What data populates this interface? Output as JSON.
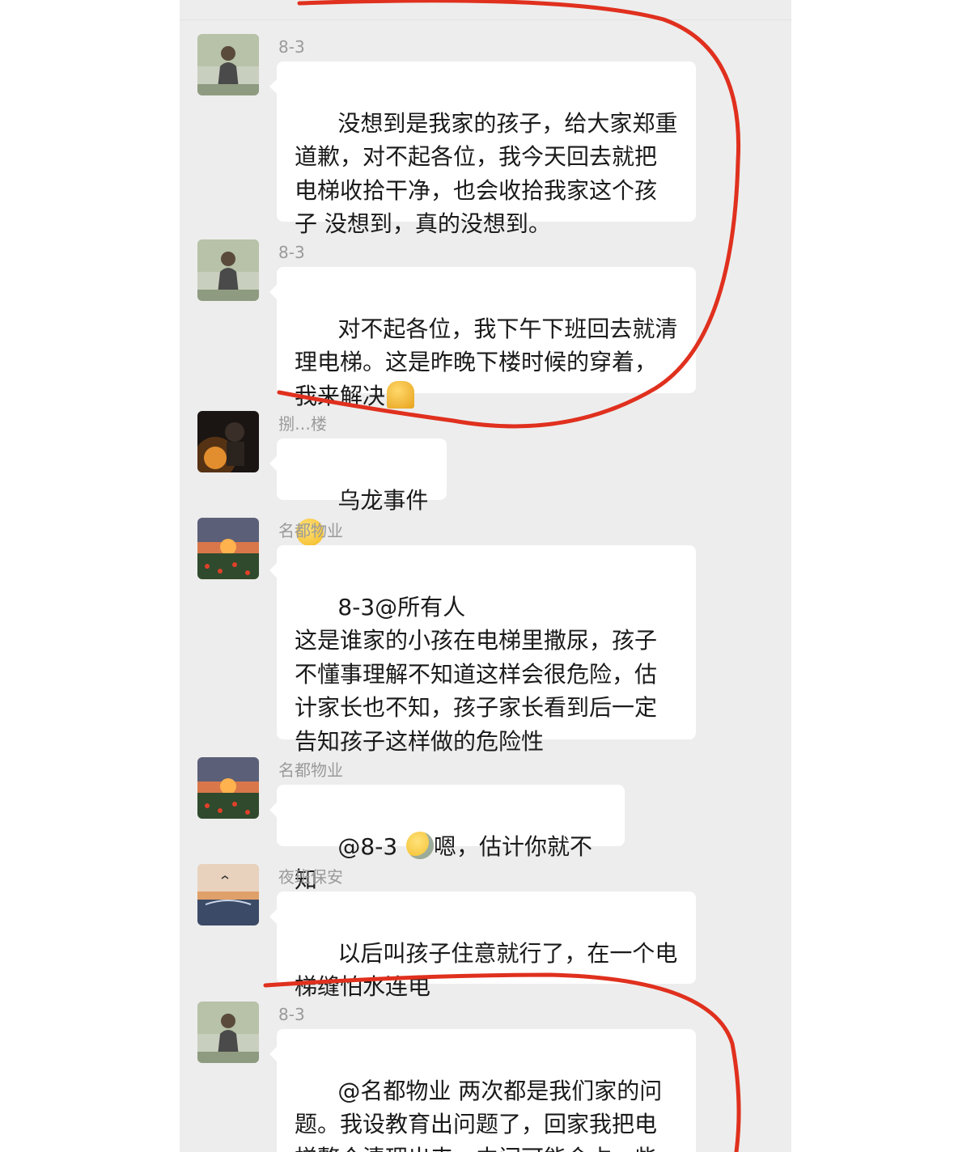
{
  "messages": [
    {
      "sender": "8-3",
      "text": "没想到是我家的孩子，给大家郑重道歉，对不起各位，我今天回去就把电梯收拾干净，也会收拾我家这个孩子 没想到，真的没想到。",
      "emoji": ""
    },
    {
      "sender": "8-3",
      "text": "对不起各位，我下午下班回去就清理电梯。这是昨晚下楼时候的穿着，我来解决",
      "emoji": "pray-emoji"
    },
    {
      "sender": "捌…楼",
      "text": "乌龙事件",
      "emoji": "thinking-emoji"
    },
    {
      "sender": "名都物业",
      "text": "8-3@所有人\n这是谁家的小孩在电梯里撒尿，孩子不懂事理解不知道这样会很危险，估计家长也不知，孩子家长看到后一定告知孩子这样做的危险性",
      "emoji": ""
    },
    {
      "sender": "名都物业",
      "text_before": "@8-3 ",
      "text": "嗯，估计你就不知",
      "emoji": "crying-laughing-emoji"
    },
    {
      "sender": "夜班保安",
      "text": "以后叫孩子住意就行了，在一个电梯缝怕水连电",
      "emoji": ""
    },
    {
      "sender": "8-3",
      "text": "@名都物业 两次都是我们家的问题。我设教育出问题了，回家我把电梯整个清理出来，中间可能会占一些电梯下楼的时间",
      "emoji": ""
    }
  ],
  "colors": {
    "chat_bg": "#ededed",
    "bubble": "#ffffff",
    "annotation": "#e0301e",
    "sender": "#9a9a9a"
  }
}
